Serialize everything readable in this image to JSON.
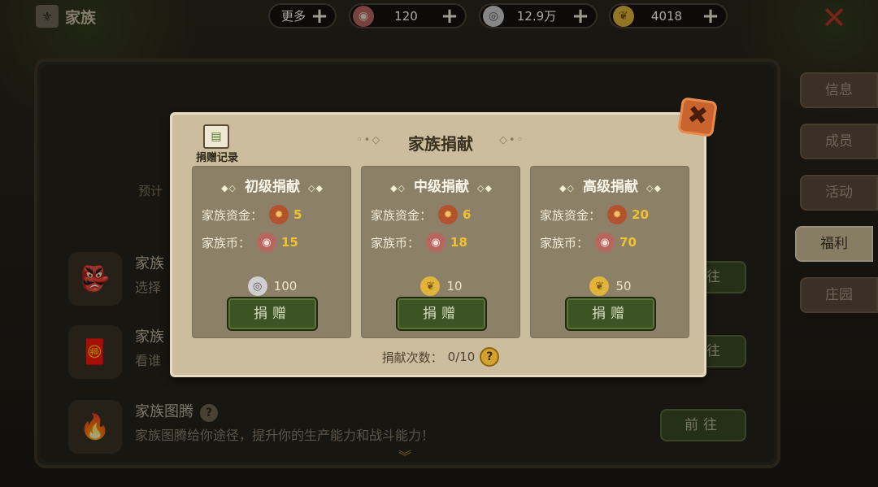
{
  "header": {
    "title": "家族",
    "more_label": "更多",
    "resources": [
      {
        "name": "family-coin",
        "value": "120"
      },
      {
        "name": "silver",
        "value": "12.9万"
      },
      {
        "name": "gold-leaf",
        "value": "4018"
      }
    ]
  },
  "background": {
    "hint_text": "预计",
    "rows": [
      {
        "title": "家族",
        "desc": "选择",
        "button": "往"
      },
      {
        "title": "家族",
        "desc": "看谁",
        "button": "往"
      },
      {
        "title": "家族图腾",
        "desc": "家族图腾给你途径，提升你的生产能力和战斗能力！",
        "button": "前往"
      }
    ]
  },
  "side_tabs": [
    "信息",
    "成员",
    "活动",
    "福利",
    "庄园"
  ],
  "active_tab": "福利",
  "modal": {
    "title": "家族捐献",
    "record_label": "捐赠记录",
    "tiers": [
      {
        "name": "初级捐献",
        "fund_label": "家族资金：",
        "fund": "5",
        "coin_label": "家族币：",
        "coin": "15",
        "cost": "100",
        "cost_type": "silver",
        "button": "捐赠"
      },
      {
        "name": "中级捐献",
        "fund_label": "家族资金：",
        "fund": "6",
        "coin_label": "家族币：",
        "coin": "18",
        "cost": "10",
        "cost_type": "gold",
        "button": "捐赠"
      },
      {
        "name": "高级捐献",
        "fund_label": "家族资金：",
        "fund": "20",
        "coin_label": "家族币：",
        "coin": "70",
        "cost": "50",
        "cost_type": "gold",
        "button": "捐赠"
      }
    ],
    "count_label": "捐献次数：",
    "count_value": "0/10",
    "help_glyph": "?"
  },
  "colors": {
    "accent_gold": "#f0c22e",
    "donate_green": "#3c5424",
    "close_orange": "#c9642e"
  }
}
